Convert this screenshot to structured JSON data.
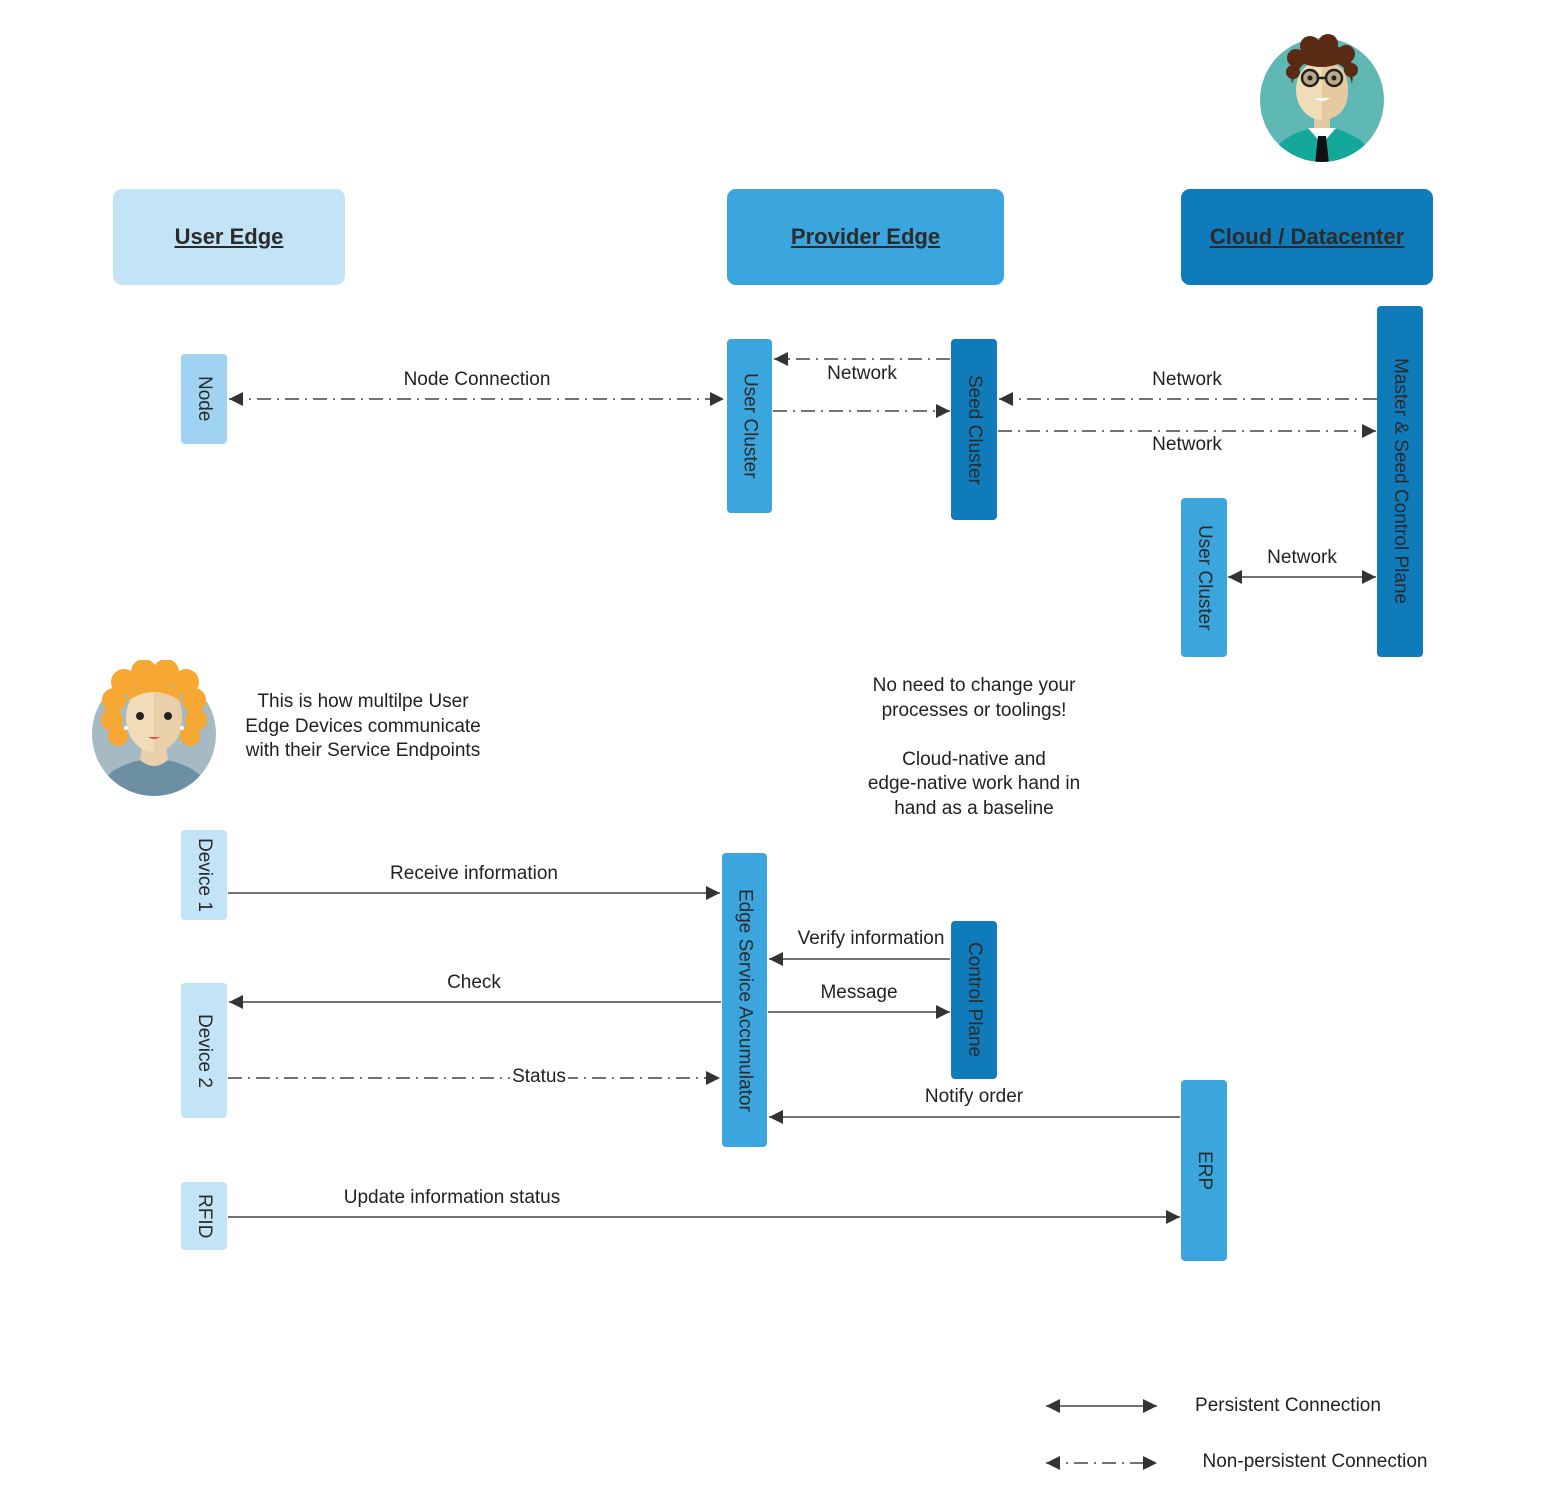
{
  "colors": {
    "light": "#c3e4f6",
    "lightBox": "#9fd3f1",
    "medium": "#3ba6dd",
    "dark": "#0f7bbb",
    "line": "#333333"
  },
  "headers": {
    "user_edge": "User Edge",
    "provider_edge": "Provider Edge",
    "cloud": "Cloud / Datacenter"
  },
  "top": {
    "node": "Node",
    "user_cluster_pe": "User Cluster",
    "seed_cluster": "Seed Cluster",
    "user_cluster_cloud": "User Cluster",
    "master_seed": "Master & Seed Control Plane",
    "edges": {
      "node_connection": "Node Connection",
      "network_pe": "Network",
      "network_seed_in": "Network",
      "network_seed_out": "Network",
      "network_cloud": "Network"
    }
  },
  "notes": {
    "user_note": "This is how multilpe User\nEdge Devices communicate\nwith their Service Endpoints",
    "cloud_note": "No need to change your\nprocesses or toolings!\n\nCloud-native and\nedge-native work hand in\nhand as a baseline"
  },
  "bottom": {
    "device1": "Device 1",
    "device2": "Device 2",
    "rfid": "RFID",
    "accumulator": "Edge Service Accumulator",
    "control_plane": "Control Plane",
    "erp": "ERP",
    "edges": {
      "receive": "Receive information",
      "check": "Check",
      "status": "Status",
      "verify": "Verify information",
      "message": "Message",
      "notify": "Notify order",
      "update": "Update information status"
    }
  },
  "legend": {
    "persistent": "Persistent Connection",
    "non_persistent": "Non-persistent Connection"
  }
}
